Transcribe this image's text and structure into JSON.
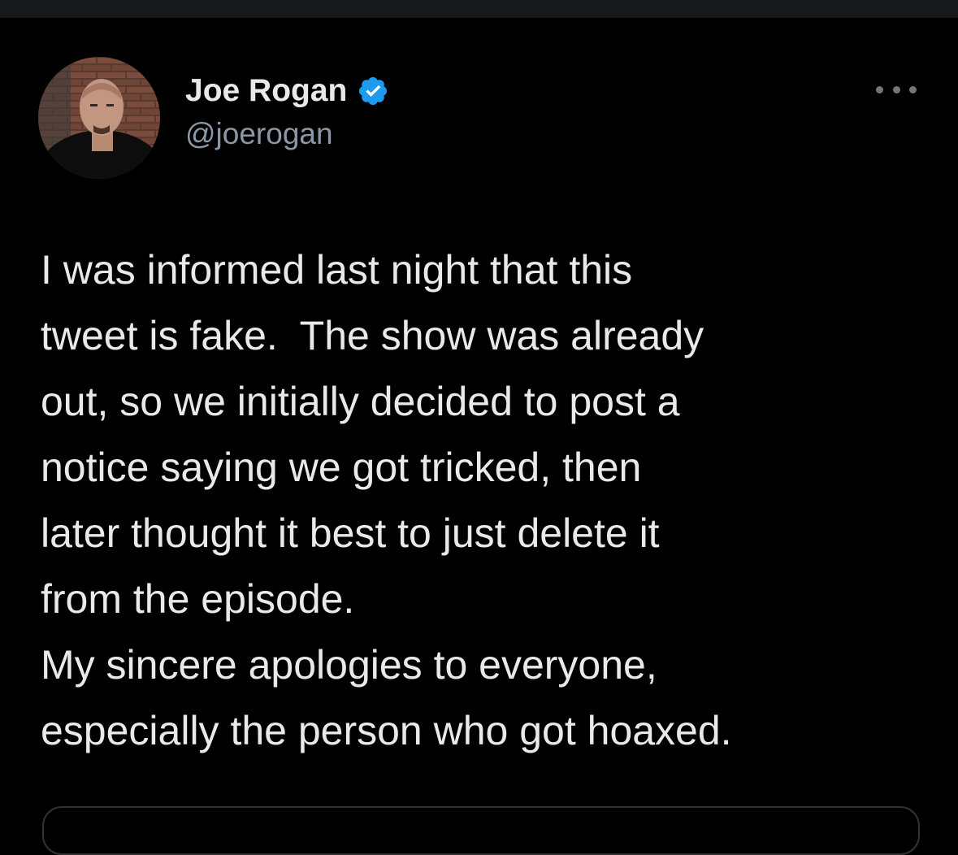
{
  "tweet": {
    "author": {
      "display_name": "Joe Rogan",
      "handle": "@joerogan",
      "verified": true,
      "verified_icon": "verified-badge-icon"
    },
    "more_icon": "more-options-icon",
    "text": "I was informed last night that this\ntweet is fake.  The show was already\nout, so we initially decided to post a\nnotice saying we got tricked, then\nlater thought it best to just delete it\nfrom the episode.\nMy sincere apologies to everyone,\nespecially the person who got hoaxed."
  },
  "colors": {
    "background": "#000000",
    "text_primary": "#e7e9ea",
    "text_secondary": "#8b98a5",
    "verified_blue": "#1d9bf0"
  }
}
